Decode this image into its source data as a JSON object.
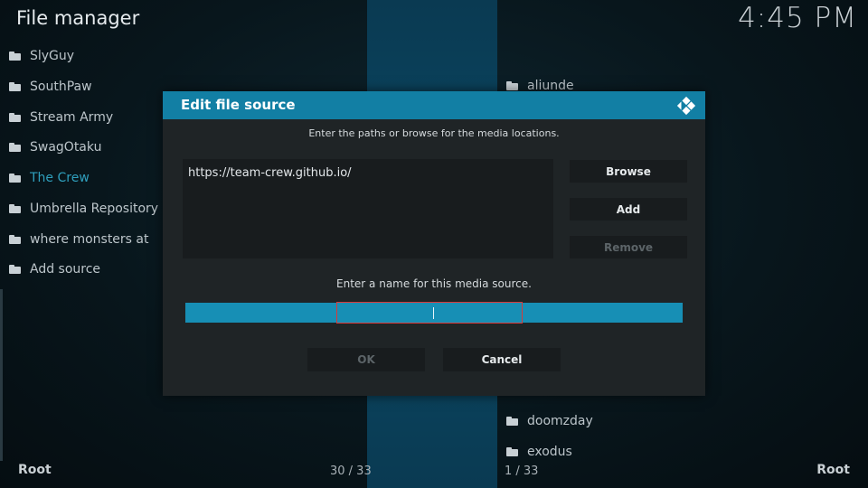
{
  "header": {
    "title": "File manager",
    "clock": "4:45 PM"
  },
  "left_pane": {
    "items": [
      {
        "label": "SlyGuy"
      },
      {
        "label": "SouthPaw"
      },
      {
        "label": "Stream Army"
      },
      {
        "label": "SwagOtaku"
      },
      {
        "label": "The Crew",
        "active": true
      },
      {
        "label": "Umbrella Repository"
      },
      {
        "label": "where monsters at"
      },
      {
        "label": "Add source"
      }
    ],
    "footer_location": "Root",
    "footer_count": "30 / 33"
  },
  "right_pane": {
    "items": [
      {
        "label": "aliunde"
      },
      {
        "label": "doomzday"
      },
      {
        "label": "exodus"
      }
    ],
    "footer_location": "Root",
    "footer_count": "1 / 33"
  },
  "dialog": {
    "title": "Edit file source",
    "instruction_paths": "Enter the paths or browse for the media locations.",
    "paths": [
      "https://team-crew.github.io/"
    ],
    "browse_label": "Browse",
    "add_label": "Add",
    "remove_label": "Remove",
    "instruction_name": "Enter a name for this media source.",
    "name_value": "",
    "ok_label": "OK",
    "cancel_label": "Cancel"
  },
  "colors": {
    "accent": "#127fa4",
    "active_text": "#2f9fbd",
    "focus_border": "#d83a3a"
  }
}
